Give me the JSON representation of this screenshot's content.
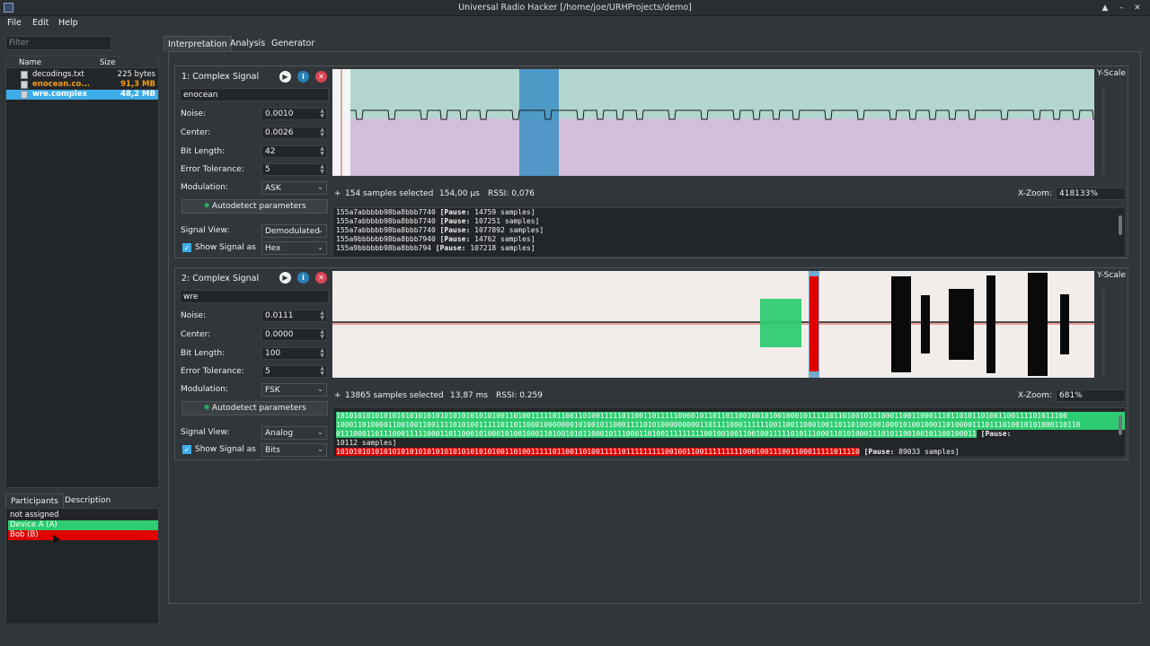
{
  "window": {
    "title": "Universal Radio Hacker [/home/joe/URHProjects/demo]",
    "controls": [
      "▲",
      "–",
      "✕"
    ]
  },
  "menu": [
    "File",
    "Edit",
    "Help"
  ],
  "filter": {
    "placeholder": "Filter"
  },
  "file_tree": {
    "headers": [
      "Name",
      "Size"
    ],
    "files": [
      {
        "name": "decodings.txt",
        "size": "225 bytes"
      },
      {
        "name": "enocean.co...",
        "size": "91,3 MB"
      },
      {
        "name": "wre.complex",
        "size": "48,2 MB"
      }
    ]
  },
  "participants": {
    "tabs": [
      "Participants",
      "Description"
    ],
    "rows": [
      {
        "label": "not assigned",
        "color": ""
      },
      {
        "label": "Device A (A)",
        "color": "#2ecc71"
      },
      {
        "label": "Bob (B)",
        "color": "#e00000"
      }
    ]
  },
  "main_tabs": [
    "Interpretation",
    "Analysis",
    "Generator"
  ],
  "labels": {
    "noise": "Noise:",
    "center": "Center:",
    "bit_length": "Bit Length:",
    "error_tolerance": "Error Tolerance:",
    "modulation": "Modulation:",
    "autodetect": "Autodetect parameters",
    "signal_view": "Signal View:",
    "show_signal_as": "Show Signal as",
    "y_scale": "Y-Scale",
    "x_zoom": "X-Zoom:",
    "plus": "+"
  },
  "signals": [
    {
      "title": "1:  Complex Signal",
      "name": "enocean",
      "noise": "0.0010",
      "center": "0.0026",
      "bit_length": "42",
      "error_tolerance": "5",
      "modulation": "ASK",
      "signal_view": "Demodulated",
      "show_as": "Hex",
      "samples_selected": "154  samples selected",
      "duration": "154,00 µs",
      "rssi": "RSSI: 0,076",
      "xzoom": "418133%",
      "protocol": [
        {
          "bits": "155a7abbbbb98ba8bbb7740 ",
          "pause": "[Pause: ",
          "samples": "14759 samples]"
        },
        {
          "bits": "155a7abbbbb98ba8bbb7740 ",
          "pause": "[Pause: ",
          "samples": "107251 samples]"
        },
        {
          "bits": "155a7abbbbb98ba8bbb7740 ",
          "pause": "[Pause: ",
          "samples": "1077892 samples]"
        },
        {
          "bits": "155a9bbbbbb98ba8bbb7940 ",
          "pause": "[Pause: ",
          "samples": "14762 samples]"
        },
        {
          "bits": "155a9bbbbbb98ba8bbb794 ",
          "pause": "[Pause: ",
          "samples": "107218 samples]"
        }
      ]
    },
    {
      "title": "2:  Complex Signal",
      "name": "wre",
      "noise": "0.0111",
      "center": "0.0000",
      "bit_length": "100",
      "error_tolerance": "5",
      "modulation": "FSK",
      "signal_view": "Analog",
      "show_as": "Bits",
      "samples_selected": "13865  samples selected",
      "duration": "13,87 ms",
      "rssi": "RSSI: 0.259",
      "xzoom": "681%",
      "protocol": [
        {
          "bits": "1010101010101010101010101010101010101001101001111101100110100111110110011011111000010110110110010010100100010111110110100101110001100110001110110101101001100111101011100",
          "pause": " [Pause: ",
          "samples": "30929 samples]",
          "bg": "#2ecc71"
        },
        {
          "bits": "1000110100001100100110011110101001111101101100010000000101001011000111101010000000001101111000111111001100110001001101101001001000101001000110100001110111010010101000110110",
          "pause": "",
          "samples": "",
          "bg": "#2ecc71"
        },
        {
          "bits": "0111000110111000111110001101100010100010100100011010010101100010111000110100111111111001001001100100111110101110001101010001110101100100101100100011",
          "pause": " [Pause: ",
          "samples": "",
          "bg": "#2ecc71"
        },
        {
          "bits": "10112 samples]",
          "pause": "",
          "samples": "",
          "bg": ""
        },
        {
          "bits": "1010101010101010101010101010101010101001101001111101100110100111110111111111001001100111111111000100111001100011111011110",
          "pause": " [Pause: ",
          "samples": "89033 samples]",
          "bg": "#e00000"
        }
      ]
    }
  ],
  "colors": {
    "accent": "#3daee9",
    "ask_upper": "#b3d7cf",
    "ask_lower": "#d3bfdc",
    "selection": "#3b8fc4",
    "device_a": "#2ecc71",
    "bob": "#e00000",
    "analog_bg": "#f2ede9"
  }
}
